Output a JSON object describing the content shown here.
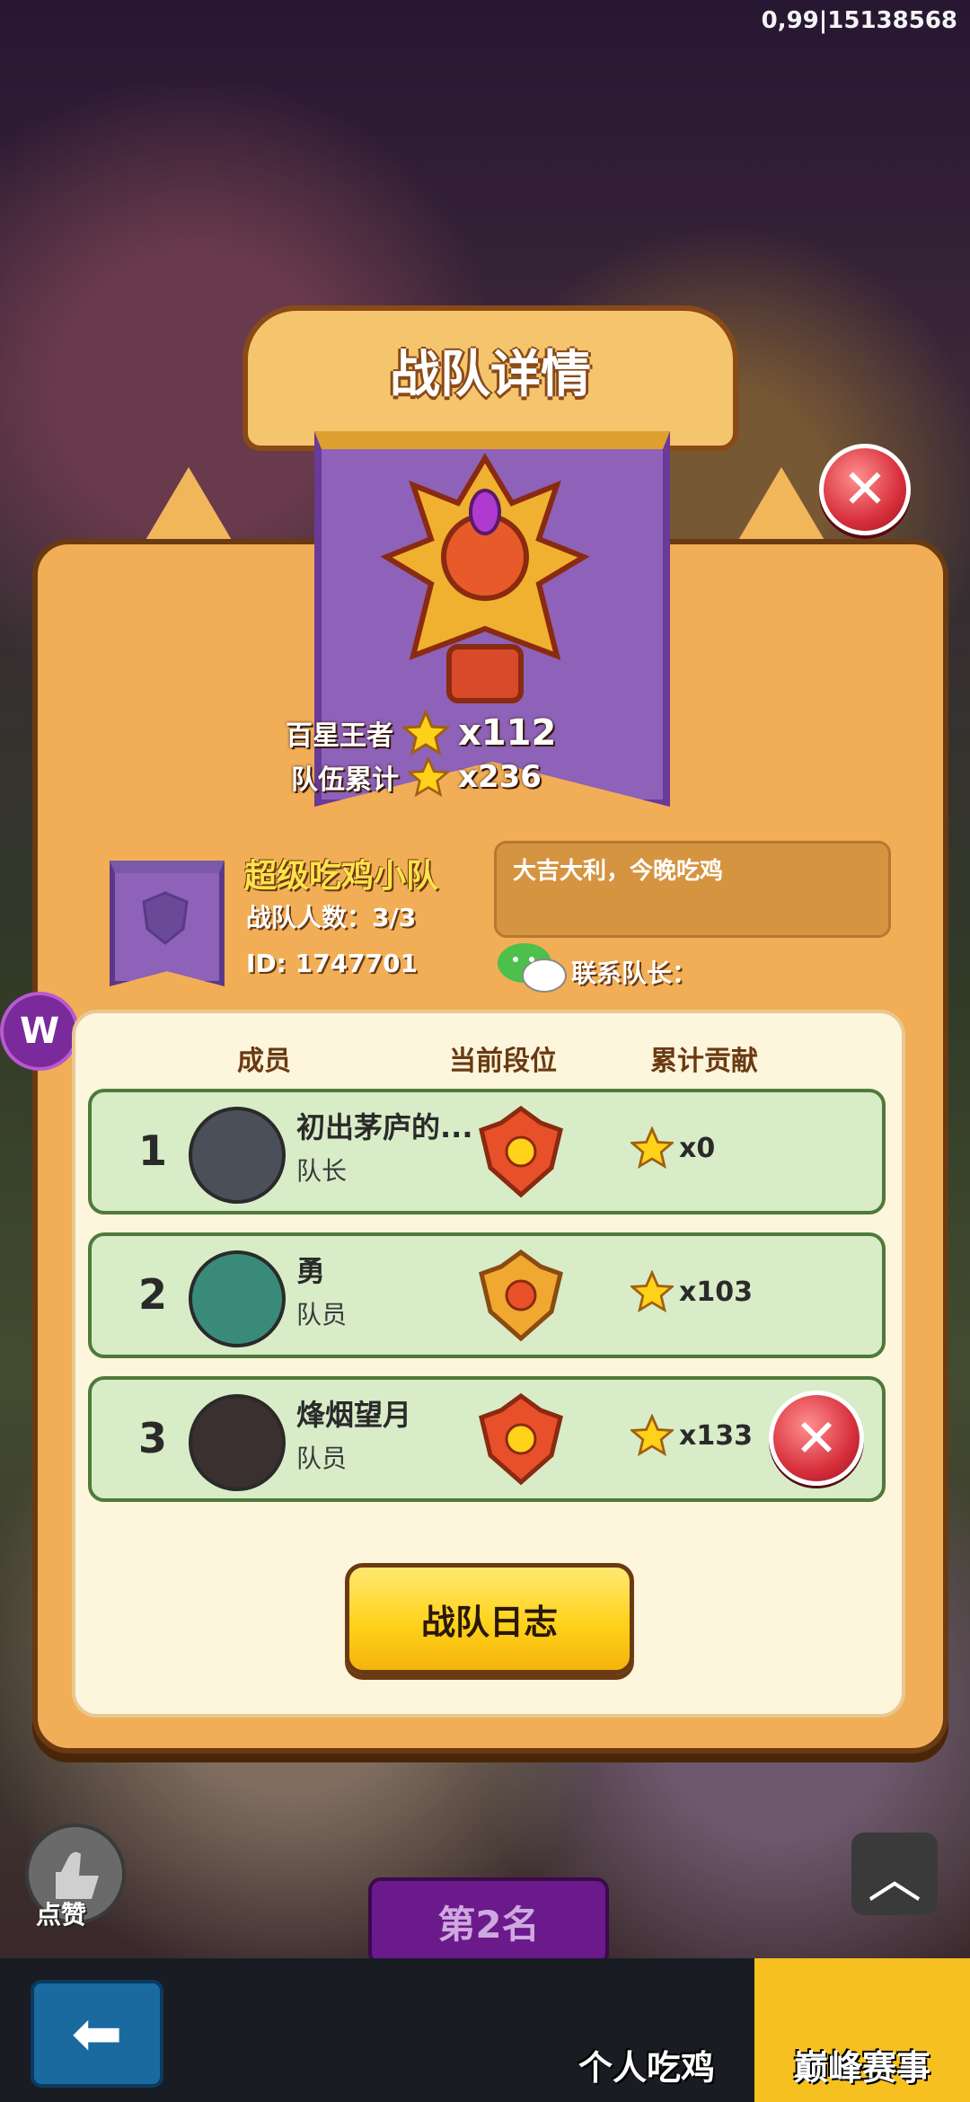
{
  "status": {
    "id_text": "0,99|15138568"
  },
  "title": "战队详情",
  "team_stats": {
    "stars_label": "百星王者",
    "stars_value": "x112",
    "total_label": "队伍累计",
    "total_value": "x236"
  },
  "team": {
    "name": "超级吃鸡小队",
    "count": "战队人数：3/3",
    "id": "ID: 1747701",
    "motto": "大吉大利，今晚吃鸡",
    "contact_label": "联系队长："
  },
  "columns": {
    "member": "成员",
    "rank": "当前段位",
    "contrib": "累计贡献"
  },
  "members": [
    {
      "num": "1",
      "name": "初出茅庐的...",
      "role": "队长",
      "contrib": "x0"
    },
    {
      "num": "2",
      "name": "勇",
      "role": "队员",
      "contrib": "x103"
    },
    {
      "num": "3",
      "name": "烽烟望月",
      "role": "队员",
      "contrib": "x133"
    }
  ],
  "log_button": "战队日志",
  "bottom": {
    "like_label": "点赞",
    "rank_tag": "第2名",
    "tab_personal": "个人吃鸡",
    "tab_peak": "巅峰赛事"
  },
  "colors": {
    "accent_yellow": "#ffd21a",
    "panel": "#f1ae56",
    "banner_purple": "#8e62b8",
    "row_green": "#d8ecc8"
  }
}
